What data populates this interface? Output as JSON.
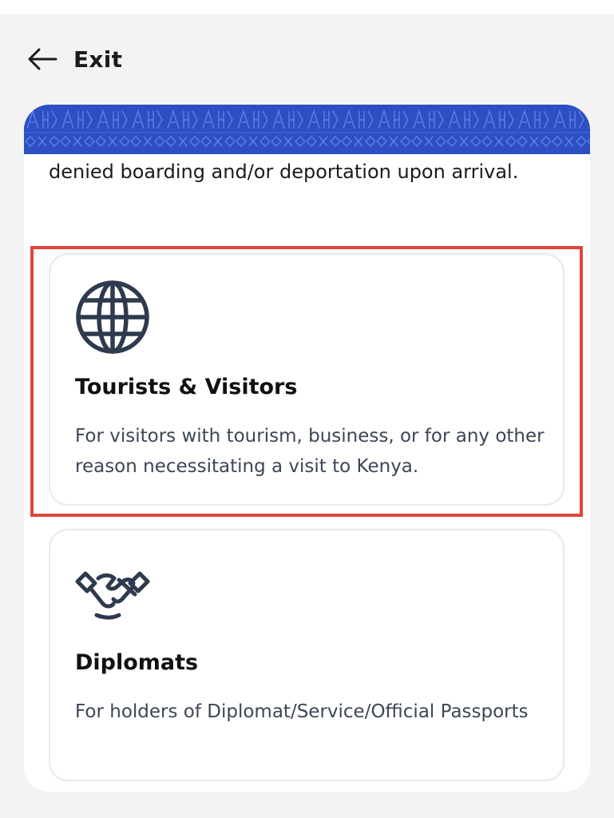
{
  "header": {
    "back_icon": "arrow-left-icon",
    "exit_label": "Exit"
  },
  "banner": {
    "color": "#2d4fc4",
    "pattern": "decorative-pattern"
  },
  "intro": {
    "text": "denied boarding and/or deportation upon arrival."
  },
  "options": [
    {
      "icon": "globe-icon",
      "title": "Tourists & Visitors",
      "description": "For visitors with tourism, business, or for any other reason necessitating a visit to Kenya.",
      "highlighted": true
    },
    {
      "icon": "handshake-icon",
      "title": "Diplomats",
      "description": "For holders of Diplomat/Service/Official Passports",
      "highlighted": false
    }
  ],
  "colors": {
    "highlight": "#e0463a",
    "icon_stroke": "#2e3a4d",
    "background": "#f3f3f4"
  }
}
